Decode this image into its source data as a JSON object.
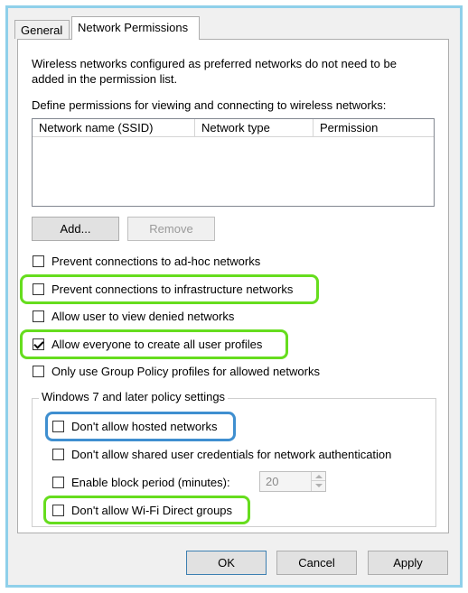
{
  "tabs": [
    {
      "label": "General"
    },
    {
      "label": "Network Permissions"
    }
  ],
  "description": {
    "line1": "Wireless networks configured as preferred networks do not need to be",
    "line2": "added in the permission list."
  },
  "define_label": "Define permissions for viewing and connecting to wireless networks:",
  "table": {
    "columns": [
      "Network name (SSID)",
      "Network type",
      "Permission"
    ],
    "rows": []
  },
  "buttons": {
    "add": "Add...",
    "remove": "Remove",
    "ok": "OK",
    "cancel": "Cancel",
    "apply": "Apply"
  },
  "options": [
    {
      "label": "Prevent connections to ad-hoc networks",
      "checked": false
    },
    {
      "label": "Prevent connections to infrastructure networks",
      "checked": false
    },
    {
      "label": "Allow user to view denied networks",
      "checked": false
    },
    {
      "label": "Allow everyone to create all user profiles",
      "checked": true
    },
    {
      "label": "Only use Group Policy profiles for allowed networks",
      "checked": false
    }
  ],
  "win7_group": {
    "title": "Windows 7 and later policy settings",
    "options": [
      {
        "label": "Don't allow hosted networks",
        "checked": false
      },
      {
        "label": "Don't allow shared user credentials for network authentication",
        "checked": false
      },
      {
        "label": "Enable block period (minutes):",
        "checked": false
      },
      {
        "label": "Don't allow Wi-Fi Direct groups",
        "checked": false
      }
    ],
    "block_period_value": "20"
  },
  "colors": {
    "highlight_green": "#66dd1e",
    "highlight_blue": "#3f8fd0",
    "frame_border": "#8fd0ea"
  }
}
